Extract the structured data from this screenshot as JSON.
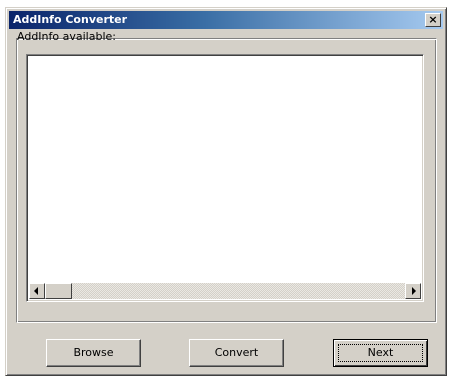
{
  "window": {
    "title": "AddInfo Converter",
    "close_label": "×"
  },
  "group": {
    "label": "AddInfo available:"
  },
  "listbox": {
    "items": []
  },
  "buttons": {
    "browse": "Browse",
    "convert": "Convert",
    "next": "Next"
  },
  "colors": {
    "title_gradient_start": "#0a246a",
    "title_gradient_end": "#a6caf0",
    "face": "#d4d0c8"
  }
}
